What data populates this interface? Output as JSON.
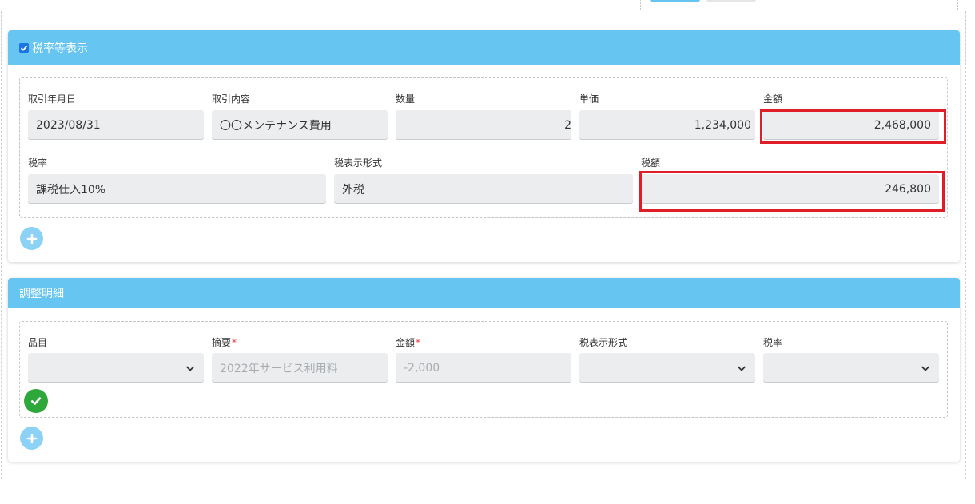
{
  "colors": {
    "header": "#67c5f2",
    "highlight": "#e01e2a",
    "add_button": "#8bd2f6",
    "confirm_button": "#2ea83a",
    "field_bg": "#ebedee"
  },
  "tax_panel": {
    "title": "税率等表示",
    "show_tax_checked": true,
    "row1": {
      "labels": {
        "date": "取引年月日",
        "content": "取引内容",
        "quantity": "数量",
        "unit_price": "単価",
        "amount": "金額"
      },
      "values": {
        "date": "2023/08/31",
        "content": "〇〇メンテナンス費用",
        "quantity": "2",
        "unit_price": "1,234,000",
        "amount": "2,468,000"
      }
    },
    "row2": {
      "labels": {
        "tax_rate": "税率",
        "tax_display": "税表示形式",
        "tax_amount": "税額"
      },
      "values": {
        "tax_rate": "課税仕入10%",
        "tax_display": "外税",
        "tax_amount": "246,800"
      }
    },
    "icons": {
      "add": "plus-icon",
      "checkbox": "check-icon"
    }
  },
  "adjust_panel": {
    "title": "調整明細",
    "labels": {
      "item": "品目",
      "summary": "摘要",
      "amount": "金額",
      "tax_display": "税表示形式",
      "tax_rate": "税率",
      "required_mark": "*"
    },
    "placeholders": {
      "summary": "2022年サービス利用料",
      "amount": "-2,000"
    },
    "icons": {
      "confirm": "check-circle-icon",
      "add": "plus-icon",
      "dropdown": "chevron-down-icon"
    }
  }
}
